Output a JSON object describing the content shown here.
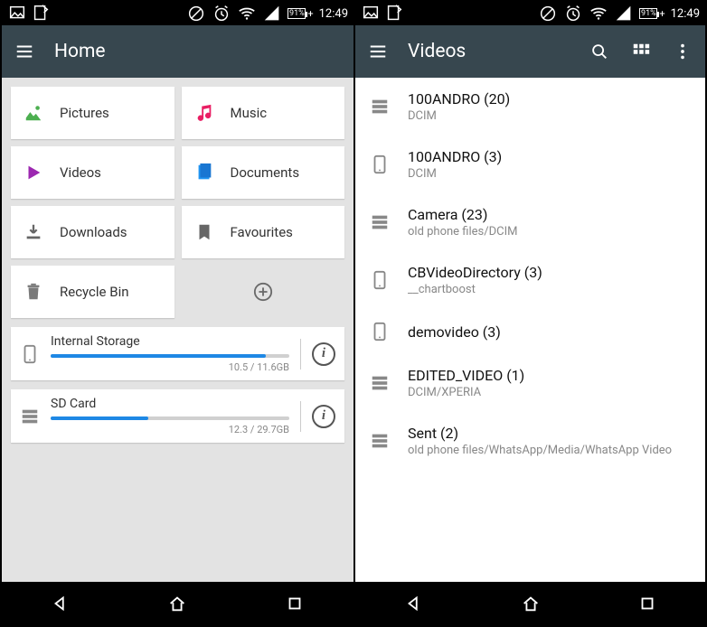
{
  "status": {
    "battery": "91%",
    "time": "12:49"
  },
  "left": {
    "title": "Home",
    "tiles": {
      "pictures": "Pictures",
      "music": "Music",
      "videos": "Videos",
      "documents": "Documents",
      "downloads": "Downloads",
      "favourites": "Favourites",
      "recycle": "Recycle Bin"
    },
    "storage": [
      {
        "label": "Internal Storage",
        "size": "10.5 / 11.6GB",
        "pct": 90
      },
      {
        "label": "SD Card",
        "size": "12.3 / 29.7GB",
        "pct": 41
      }
    ]
  },
  "right": {
    "title": "Videos",
    "items": [
      {
        "name": "100ANDRO (20)",
        "path": "DCIM",
        "icon": "storage"
      },
      {
        "name": "100ANDRO (3)",
        "path": "DCIM",
        "icon": "phone"
      },
      {
        "name": "Camera (23)",
        "path": "old phone files/DCIM",
        "icon": "storage"
      },
      {
        "name": "CBVideoDirectory (3)",
        "path": "__chartboost",
        "icon": "phone"
      },
      {
        "name": "demovideo (3)",
        "path": "",
        "icon": "phone"
      },
      {
        "name": "EDITED_VIDEO (1)",
        "path": "DCIM/XPERIA",
        "icon": "storage"
      },
      {
        "name": "Sent (2)",
        "path": "old phone files/WhatsApp/Media/WhatsApp Video",
        "icon": "storage"
      }
    ]
  }
}
